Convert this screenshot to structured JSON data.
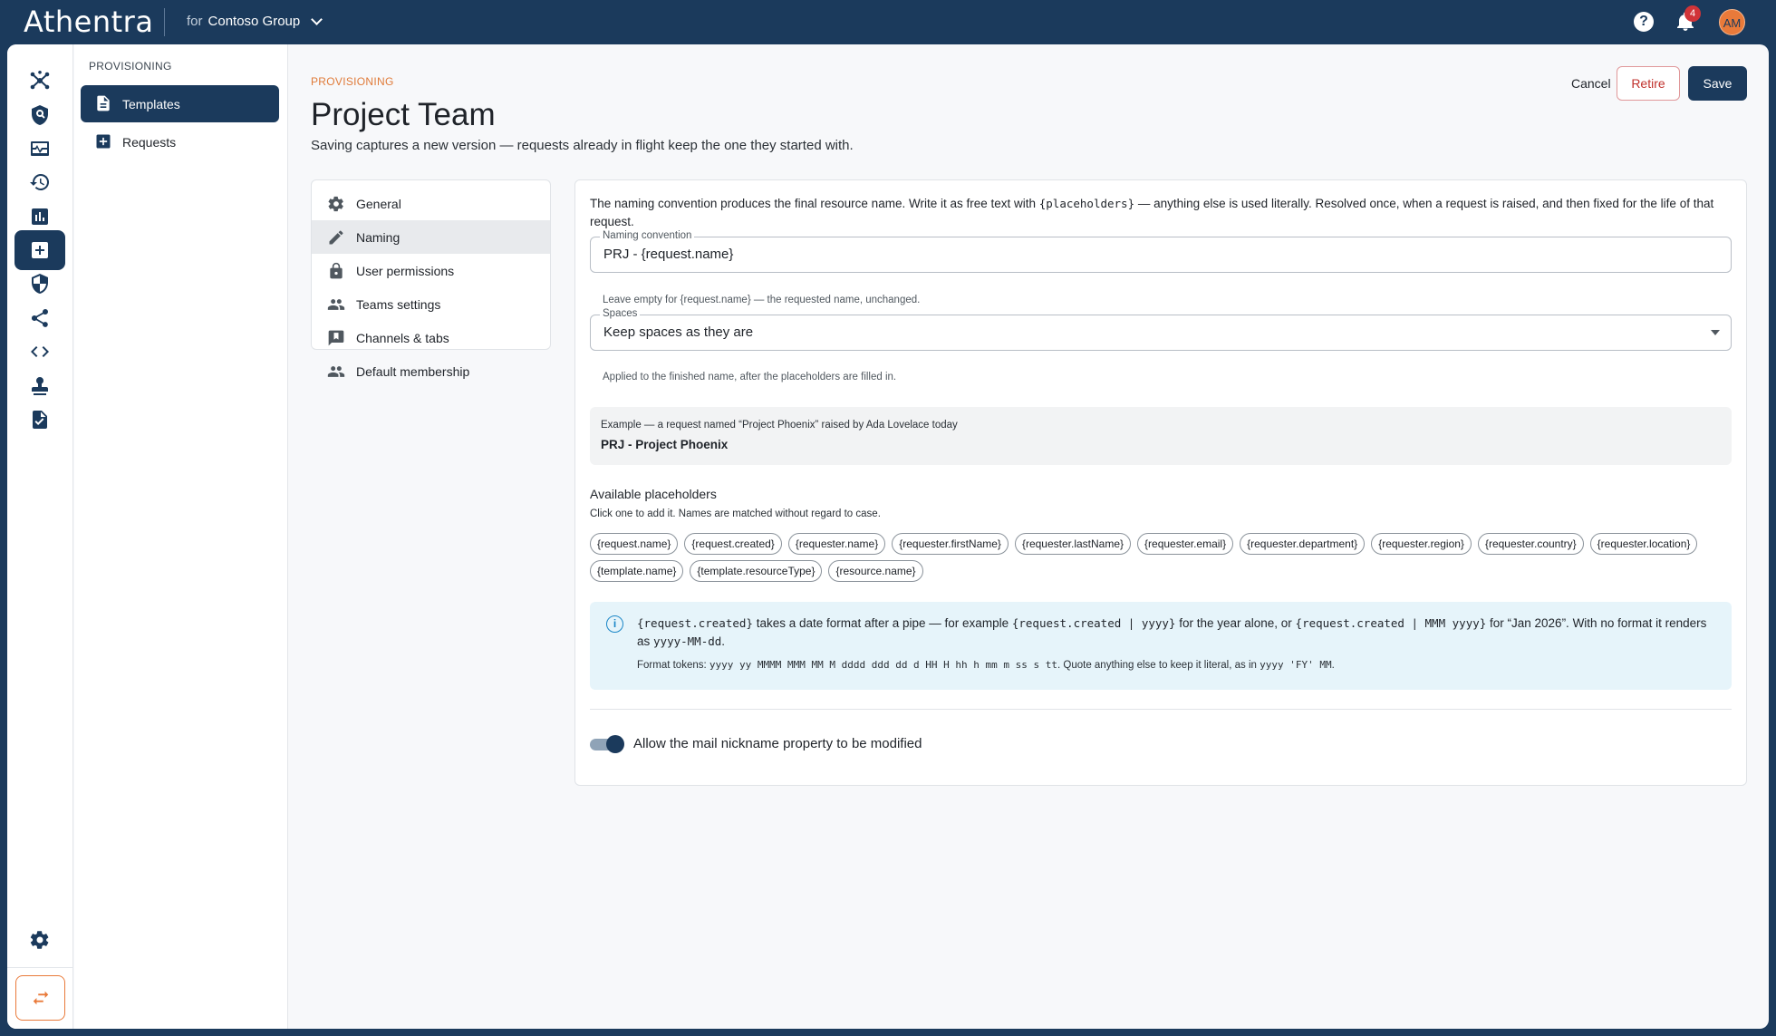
{
  "app": {
    "logo": "Athentra",
    "tenant_prefix": "for",
    "tenant_name": "Contoso Group",
    "notifications_count": "4",
    "user_initials": "AM"
  },
  "rail": {
    "items": [
      "network-icon",
      "search-shield-icon",
      "monitor-pulse-icon",
      "history-icon",
      "bar-chart-icon",
      "add-box-icon",
      "shield-icon",
      "share-icon",
      "code-icon",
      "stamp-icon",
      "clipboard-check-icon"
    ],
    "active": "add-box-icon",
    "settings": "gear-icon",
    "switch": "swap-arrows-icon"
  },
  "subnav": {
    "heading": "PROVISIONING",
    "items": [
      {
        "label": "Templates",
        "icon": "document-icon"
      },
      {
        "label": "Requests",
        "icon": "add-square-icon"
      }
    ]
  },
  "page": {
    "eyebrow": "PROVISIONING",
    "title": "Project Team",
    "subtitle": "Saving captures a new version — requests already in flight keep the one they started with.",
    "actions": {
      "cancel": "Cancel",
      "retire": "Retire",
      "save": "Save"
    }
  },
  "tabs": [
    {
      "label": "General",
      "icon": "gear-icon"
    },
    {
      "label": "Naming",
      "icon": "pencil-icon"
    },
    {
      "label": "User permissions",
      "icon": "lock-icon"
    },
    {
      "label": "Teams settings",
      "icon": "people-icon"
    },
    {
      "label": "Channels & tabs",
      "icon": "chat-flag-icon"
    },
    {
      "label": "Default membership",
      "icon": "people-icon"
    }
  ],
  "naming": {
    "intro_a": "The naming convention produces the final resource name. Write it as free text with ",
    "intro_code": "{placeholders}",
    "intro_b": " — anything else is used literally. Resolved once, when a request is raised, and then fixed for the life of that request.",
    "convention_label": "Naming convention",
    "convention_value": "PRJ - {request.name}",
    "convention_help": "Leave empty for {request.name} — the requested name, unchanged.",
    "spaces_label": "Spaces",
    "spaces_value": "Keep spaces as they are",
    "spaces_help": "Applied to the finished name, after the placeholders are filled in.",
    "example_caption": "Example — a request named “Project Phoenix” raised by Ada Lovelace today",
    "example_value": "PRJ - Project Phoenix",
    "placeholders_title": "Available placeholders",
    "placeholders_sub": "Click one to add it. Names are matched without regard to case.",
    "placeholders": [
      "{request.name}",
      "{request.created}",
      "{requester.name}",
      "{requester.firstName}",
      "{requester.lastName}",
      "{requester.email}",
      "{requester.department}",
      "{requester.region}",
      "{requester.country}",
      "{requester.location}",
      "{template.name}",
      "{template.resourceType}",
      "{resource.name}"
    ],
    "info": {
      "code1": "{request.created}",
      "t1": " takes a date format after a pipe — for example ",
      "code2": "{request.created | yyyy}",
      "t2": " for the year alone, or ",
      "code3": "{request.created | MMM yyyy}",
      "t3": " for “Jan 2026”. With no format it renders as ",
      "code4": "yyyy-MM-dd",
      "t4": ".",
      "tokens_label": "Format tokens: ",
      "tokens_code": "yyyy yy MMMM MMM MM M dddd ddd dd d HH H hh h mm m ss s tt",
      "tokens_text": ". Quote anything else to keep it literal, as in ",
      "tokens_example": "yyyy 'FY' MM",
      "tokens_end": "."
    },
    "toggle_label": "Allow the mail nickname property to be modified",
    "toggle_on": true
  }
}
